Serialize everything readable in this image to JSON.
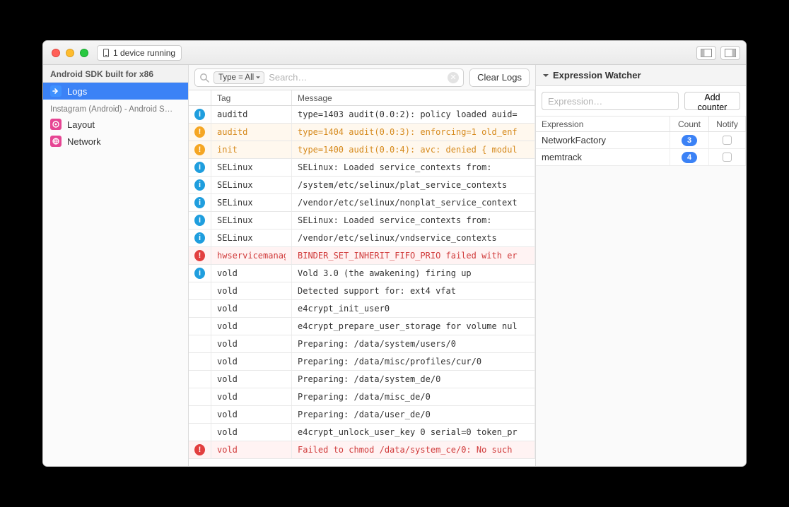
{
  "titlebar": {
    "device_status": "1 device running"
  },
  "sidebar": {
    "group1_title": "Android SDK built for x86",
    "logs_label": "Logs",
    "group2_title": "Instagram (Android) - Android S…",
    "layout_label": "Layout",
    "network_label": "Network"
  },
  "toolbar": {
    "type_chip": "Type = All",
    "search_placeholder": "Search…",
    "clear_label": "Clear Logs"
  },
  "columns": {
    "icon": "",
    "tag": "Tag",
    "message": "Message"
  },
  "logs": [
    {
      "level": "info",
      "tag": "auditd",
      "msg": "type=1403 audit(0.0:2): policy loaded auid="
    },
    {
      "level": "warn",
      "tag": "auditd",
      "msg": "type=1404 audit(0.0:3): enforcing=1 old_enf"
    },
    {
      "level": "warn",
      "tag": "init",
      "msg": "type=1400 audit(0.0:4): avc: denied { modul"
    },
    {
      "level": "info",
      "tag": "SELinux",
      "msg": "SELinux: Loaded service_contexts from:"
    },
    {
      "level": "info",
      "tag": "SELinux",
      "msg": "/system/etc/selinux/plat_service_contexts"
    },
    {
      "level": "info",
      "tag": "SELinux",
      "msg": "/vendor/etc/selinux/nonplat_service_context"
    },
    {
      "level": "info",
      "tag": "SELinux",
      "msg": "SELinux: Loaded service_contexts from:"
    },
    {
      "level": "info",
      "tag": "SELinux",
      "msg": "/vendor/etc/selinux/vndservice_contexts"
    },
    {
      "level": "err",
      "tag": "hwservicemanag",
      "msg": "BINDER_SET_INHERIT_FIFO_PRIO failed with er"
    },
    {
      "level": "info",
      "tag": "vold",
      "msg": "Vold 3.0 (the awakening) firing up"
    },
    {
      "level": "none",
      "tag": "vold",
      "msg": "Detected support for: ext4 vfat"
    },
    {
      "level": "none",
      "tag": "vold",
      "msg": "e4crypt_init_user0"
    },
    {
      "level": "none",
      "tag": "vold",
      "msg": "e4crypt_prepare_user_storage for volume nul"
    },
    {
      "level": "none",
      "tag": "vold",
      "msg": "Preparing: /data/system/users/0"
    },
    {
      "level": "none",
      "tag": "vold",
      "msg": "Preparing: /data/misc/profiles/cur/0"
    },
    {
      "level": "none",
      "tag": "vold",
      "msg": "Preparing: /data/system_de/0"
    },
    {
      "level": "none",
      "tag": "vold",
      "msg": "Preparing: /data/misc_de/0"
    },
    {
      "level": "none",
      "tag": "vold",
      "msg": "Preparing: /data/user_de/0"
    },
    {
      "level": "none",
      "tag": "vold",
      "msg": "e4crypt_unlock_user_key 0 serial=0 token_pr"
    },
    {
      "level": "err",
      "tag": "vold",
      "msg": "Failed to chmod /data/system_ce/0: No such"
    }
  ],
  "watcher": {
    "title": "Expression Watcher",
    "input_placeholder": "Expression…",
    "add_label": "Add counter",
    "cols": {
      "expr": "Expression",
      "count": "Count",
      "notify": "Notify"
    },
    "items": [
      {
        "expr": "NetworkFactory",
        "count": "3",
        "notify": false
      },
      {
        "expr": "memtrack",
        "count": "4",
        "notify": false
      }
    ]
  }
}
